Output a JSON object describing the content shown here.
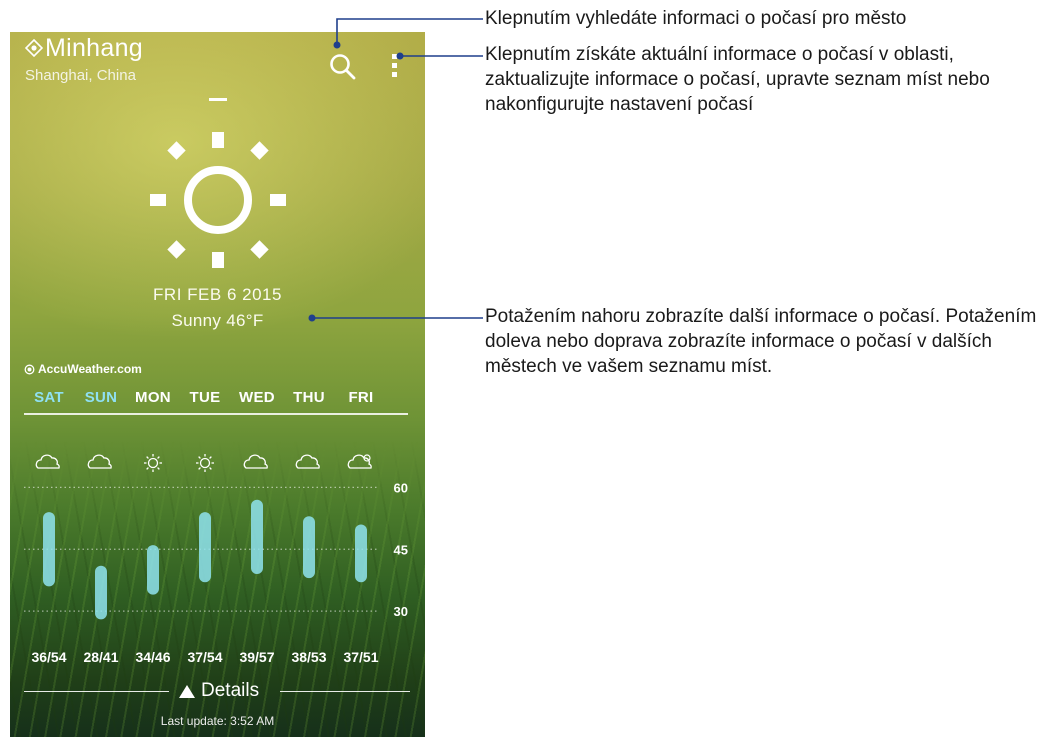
{
  "location": {
    "city": "Minhang",
    "region": "Shanghai, China"
  },
  "today": {
    "date": "FRI FEB 6 2015",
    "condition": "Sunny 46°F"
  },
  "provider": "AccuWeather.com",
  "forecast": {
    "days": [
      {
        "label": "SAT",
        "icon": "cloud-icon",
        "weekend": true
      },
      {
        "label": "SUN",
        "icon": "cloud-icon",
        "weekend": true
      },
      {
        "label": "MON",
        "icon": "sun-icon",
        "weekend": false
      },
      {
        "label": "TUE",
        "icon": "sun-icon",
        "weekend": false
      },
      {
        "label": "WED",
        "icon": "cloud-icon",
        "weekend": false
      },
      {
        "label": "THU",
        "icon": "cloud-icon",
        "weekend": false
      },
      {
        "label": "FRI",
        "icon": "partly-cloudy-icon",
        "weekend": false
      }
    ],
    "ranges": [
      "36/54",
      "28/41",
      "34/46",
      "37/54",
      "39/57",
      "38/53",
      "37/51"
    ]
  },
  "chart_data": {
    "type": "bar",
    "categories": [
      "SAT",
      "SUN",
      "MON",
      "TUE",
      "WED",
      "THU",
      "FRI"
    ],
    "series": [
      {
        "low": [
          36,
          28,
          34,
          37,
          39,
          38,
          37
        ],
        "high": [
          54,
          41,
          46,
          54,
          57,
          53,
          51
        ]
      }
    ],
    "yticks": [
      "60",
      "45",
      "30"
    ],
    "ylim": [
      23,
      63
    ],
    "grid": true
  },
  "details_label": "Details",
  "last_update": "Last update: 3:52 AM",
  "annotations": {
    "search": "Klepnutím vyhledáte informaci o počasí pro město",
    "menu": "Klepnutím získáte aktuální informace o počasí v oblasti, zaktualizujte informace o počasí, upravte seznam míst nebo nakonfigurujte nastavení počasí",
    "swipe": "Potažením nahoru zobrazíte další informace o počasí. Potažením doleva nebo doprava zobrazíte informace o počasí v dalších městech ve vašem seznamu míst."
  },
  "colors": {
    "bar": "#8fe3ee",
    "weekend": "#8fe0f2",
    "callout_line": "#1f3f8c"
  }
}
